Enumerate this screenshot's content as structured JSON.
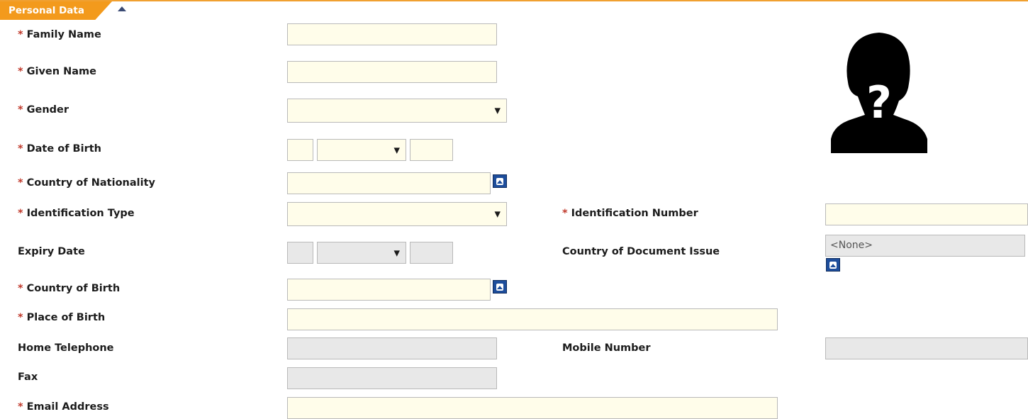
{
  "section": {
    "title": "Personal Data"
  },
  "required_marker": "*",
  "labels": {
    "family_name": "Family Name",
    "given_name": "Given Name",
    "gender": "Gender",
    "date_of_birth": "Date of Birth",
    "country_of_nationality": "Country of Nationality",
    "identification_type": "Identification Type",
    "identification_number": "Identification Number",
    "expiry_date": "Expiry Date",
    "country_of_document_issue": "Country of Document Issue",
    "country_of_birth": "Country of Birth",
    "place_of_birth": "Place of Birth",
    "home_telephone": "Home Telephone",
    "mobile_number": "Mobile Number",
    "fax": "Fax",
    "email_address": "Email Address"
  },
  "values": {
    "country_of_document_issue": "<None>"
  },
  "icons": {
    "collapse": "triangle-up-icon",
    "lookup": "lookup-up-icon",
    "photo": "unknown-person-silhouette",
    "dropdown": "triangle-down-icon"
  },
  "colors": {
    "accent": "#f39a1c",
    "required": "#c0392b",
    "field_bg": "#fffdea",
    "disabled_bg": "#e8e8e8",
    "lookup_button": "#1d4d9b"
  }
}
